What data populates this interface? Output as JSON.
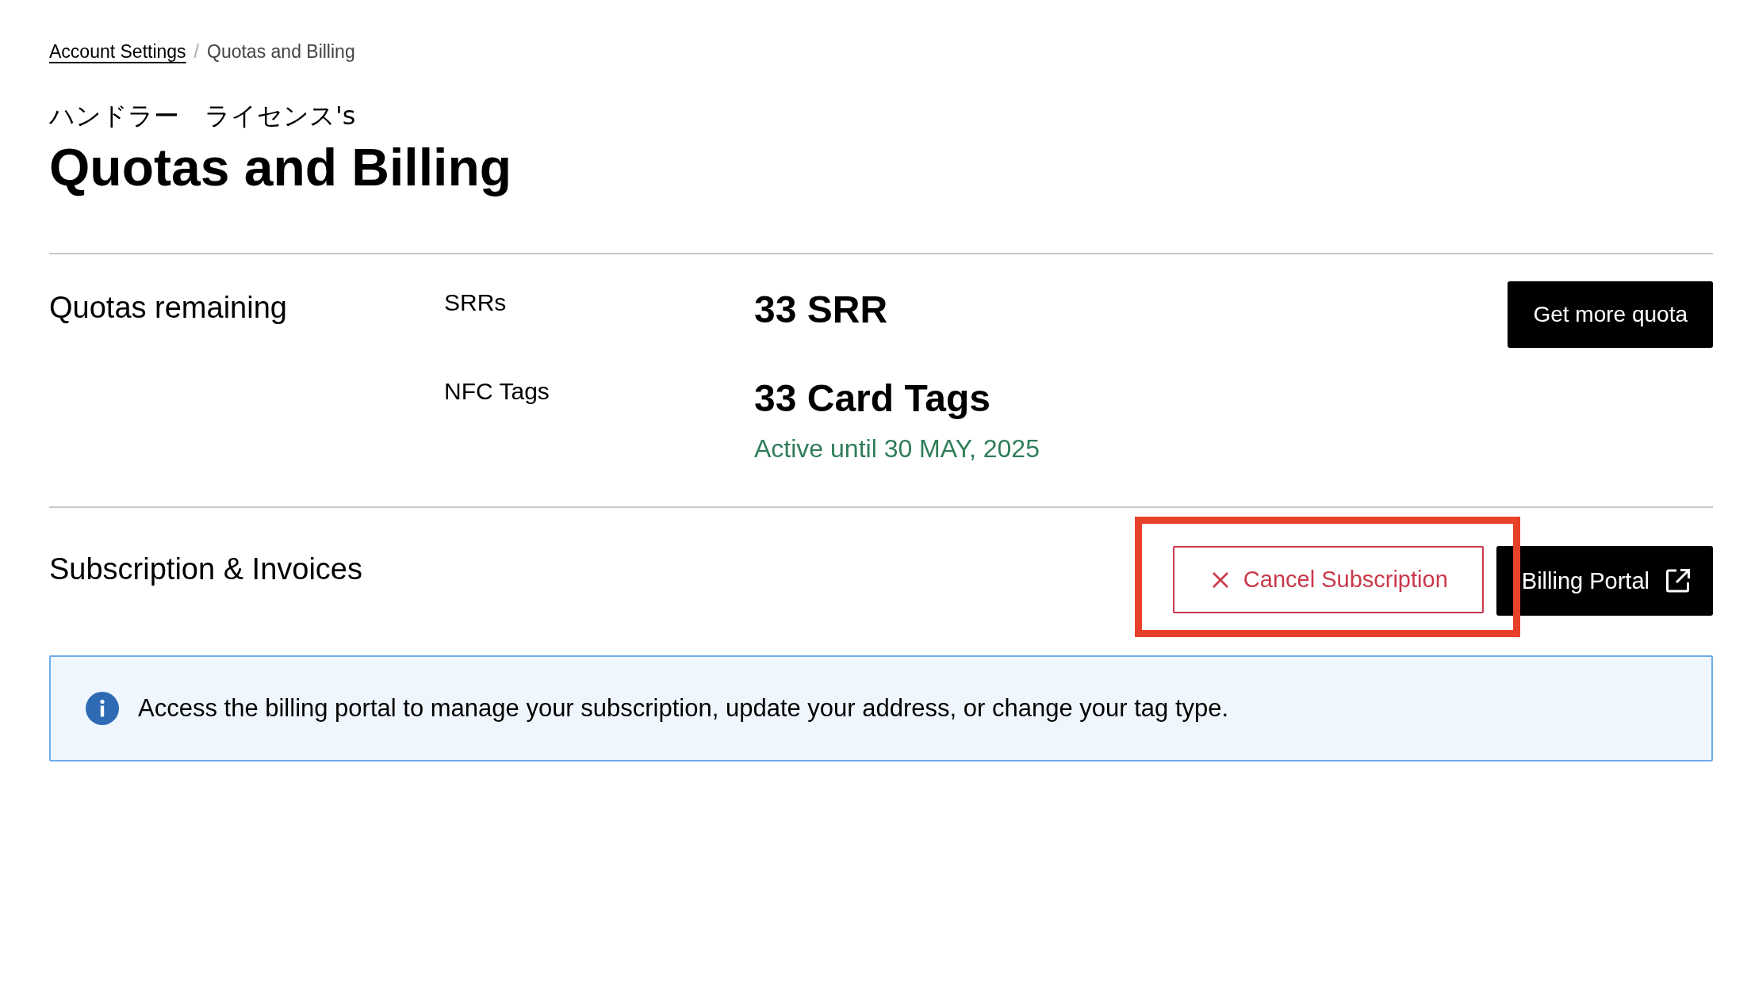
{
  "breadcrumb": [
    {
      "label": "Account Settings",
      "link": true
    },
    {
      "label": "Quotas and Billing",
      "link": false
    }
  ],
  "breadcrumb_separator": "/",
  "subtitle": "ハンドラー　ライセンス's",
  "title": "Quotas and Billing",
  "quotas": {
    "heading": "Quotas remaining",
    "rows": [
      {
        "label": "SRRs",
        "value": "33 SRR"
      },
      {
        "label": "NFC Tags",
        "value": "33 Card Tags"
      }
    ],
    "active_until": "Active until 30 MAY, 2025",
    "button": "Get more quota"
  },
  "subscription": {
    "heading": "Subscription & Invoices",
    "cancel_button": {
      "label": "Cancel Subscription",
      "highlighted": true
    },
    "portal_button": "Billing Portal"
  },
  "notice": "Access the billing portal to manage your subscription, update your address, or change your tag type."
}
